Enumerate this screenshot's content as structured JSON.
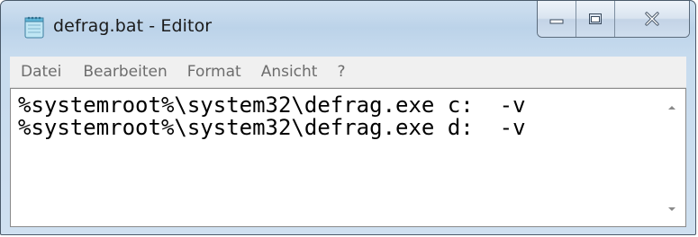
{
  "window": {
    "title": "defrag.bat - Editor"
  },
  "titlebar": {
    "app_icon": "notepad-icon",
    "buttons": {
      "minimize_icon": "minimize-icon",
      "maximize_icon": "maximize-icon",
      "close_icon": "close-icon"
    }
  },
  "menubar": {
    "items": [
      {
        "label": "Datei"
      },
      {
        "label": "Bearbeiten"
      },
      {
        "label": "Format"
      },
      {
        "label": "Ansicht"
      },
      {
        "label": "?"
      }
    ]
  },
  "editor": {
    "lines": [
      "%systemroot%\\system32\\defrag.exe c:  -v",
      "%systemroot%\\system32\\defrag.exe d:  -v"
    ]
  },
  "scrollbar": {
    "up_icon": "scroll-up-arrow-icon",
    "down_icon": "scroll-down-arrow-icon"
  },
  "colors": {
    "frame": "#bcd3e9",
    "menu_text": "#6d6d6d",
    "editor_bg": "#ffffff"
  }
}
